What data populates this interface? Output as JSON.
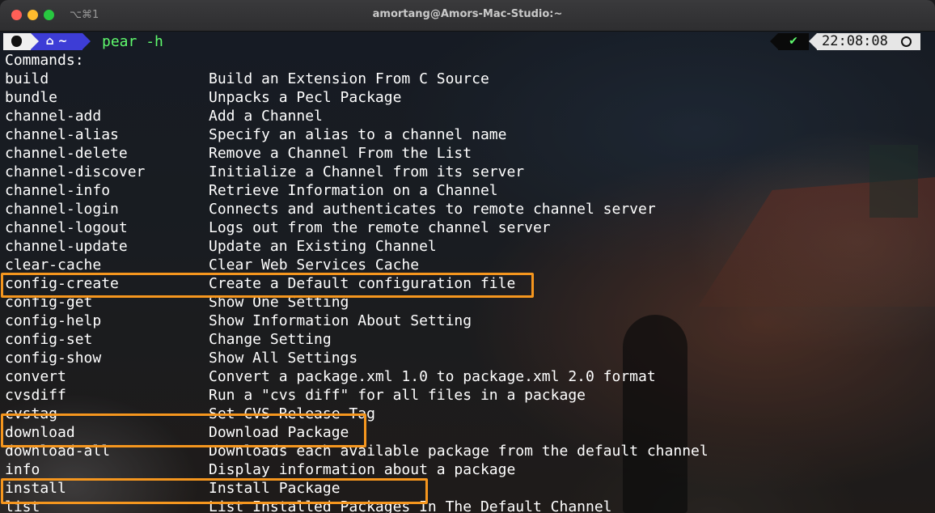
{
  "window": {
    "title": "amortang@Amors-Mac-Studio:~",
    "shortcut": "⌥⌘1"
  },
  "prompt": {
    "home_segment": "⌂ ~",
    "command": "pear",
    "argument": "-h",
    "status_glyph": "✔",
    "time": "22:08:08"
  },
  "output": {
    "header": "Commands:",
    "commands": [
      {
        "name": "build",
        "desc": "Build an Extension From C Source"
      },
      {
        "name": "bundle",
        "desc": "Unpacks a Pecl Package"
      },
      {
        "name": "channel-add",
        "desc": "Add a Channel"
      },
      {
        "name": "channel-alias",
        "desc": "Specify an alias to a channel name"
      },
      {
        "name": "channel-delete",
        "desc": "Remove a Channel From the List"
      },
      {
        "name": "channel-discover",
        "desc": "Initialize a Channel from its server"
      },
      {
        "name": "channel-info",
        "desc": "Retrieve Information on a Channel"
      },
      {
        "name": "channel-login",
        "desc": "Connects and authenticates to remote channel server"
      },
      {
        "name": "channel-logout",
        "desc": "Logs out from the remote channel server"
      },
      {
        "name": "channel-update",
        "desc": "Update an Existing Channel"
      },
      {
        "name": "clear-cache",
        "desc": "Clear Web Services Cache"
      },
      {
        "name": "config-create",
        "desc": "Create a Default configuration file"
      },
      {
        "name": "config-get",
        "desc": "Show One Setting"
      },
      {
        "name": "config-help",
        "desc": "Show Information About Setting"
      },
      {
        "name": "config-set",
        "desc": "Change Setting"
      },
      {
        "name": "config-show",
        "desc": "Show All Settings"
      },
      {
        "name": "convert",
        "desc": "Convert a package.xml 1.0 to package.xml 2.0 format"
      },
      {
        "name": "cvsdiff",
        "desc": "Run a \"cvs diff\" for all files in a package"
      },
      {
        "name": "cvstag",
        "desc": "Set CVS Release Tag"
      },
      {
        "name": "download",
        "desc": "Download Package"
      },
      {
        "name": "download-all",
        "desc": "Downloads each available package from the default channel"
      },
      {
        "name": "info",
        "desc": "Display information about a package"
      },
      {
        "name": "install",
        "desc": "Install Package"
      },
      {
        "name": "list",
        "desc": "List Installed Packages In The Default Channel"
      }
    ]
  },
  "colors": {
    "highlight": "#f5961e",
    "command": "#5ffb6e",
    "text": "#ffffff"
  }
}
